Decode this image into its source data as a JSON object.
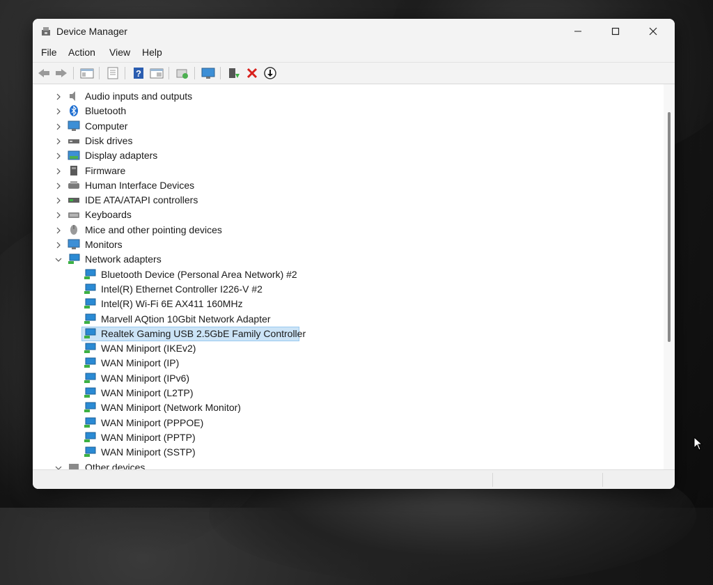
{
  "window": {
    "title": "Device Manager"
  },
  "menu": [
    "File",
    "Action",
    "View",
    "Help"
  ],
  "toolbar": [
    "back-icon",
    "forward-icon",
    "show-hide-tree-icon",
    "properties-icon",
    "help-icon",
    "view-icon",
    "scan-hardware-icon",
    "monitor-icon",
    "update-driver-icon",
    "uninstall-icon",
    "download-icon"
  ],
  "tree": {
    "categories": [
      {
        "label": "Audio inputs and outputs",
        "icon": "speaker-icon"
      },
      {
        "label": "Bluetooth",
        "icon": "bluetooth-icon"
      },
      {
        "label": "Computer",
        "icon": "computer-icon"
      },
      {
        "label": "Disk drives",
        "icon": "disk-icon"
      },
      {
        "label": "Display adapters",
        "icon": "display-adapter-icon"
      },
      {
        "label": "Firmware",
        "icon": "firmware-icon"
      },
      {
        "label": "Human Interface Devices",
        "icon": "hid-icon"
      },
      {
        "label": "IDE ATA/ATAPI controllers",
        "icon": "ide-icon"
      },
      {
        "label": "Keyboards",
        "icon": "keyboard-icon"
      },
      {
        "label": "Mice and other pointing devices",
        "icon": "mouse-icon"
      },
      {
        "label": "Monitors",
        "icon": "monitor-icon"
      },
      {
        "label": "Network adapters",
        "icon": "network-icon",
        "expanded": true
      }
    ],
    "network_children": [
      "Bluetooth Device (Personal Area Network) #2",
      "Intel(R) Ethernet Controller I226-V #2",
      "Intel(R) Wi-Fi 6E AX411 160MHz",
      "Marvell AQtion 10Gbit Network Adapter",
      "Realtek Gaming USB 2.5GbE Family Controller",
      "WAN Miniport (IKEv2)",
      "WAN Miniport (IP)",
      "WAN Miniport (IPv6)",
      "WAN Miniport (L2TP)",
      "WAN Miniport (Network Monitor)",
      "WAN Miniport (PPPOE)",
      "WAN Miniport (PPTP)",
      "WAN Miniport (SSTP)"
    ],
    "selected": "Realtek Gaming USB 2.5GbE Family Controller",
    "partial": {
      "label": "Other devices",
      "icon": "other-devices-icon"
    }
  },
  "colors": {
    "selection_bg": "#cce4f7",
    "selection_border": "#99c9ef",
    "net_icon": "#2a8ad4"
  }
}
